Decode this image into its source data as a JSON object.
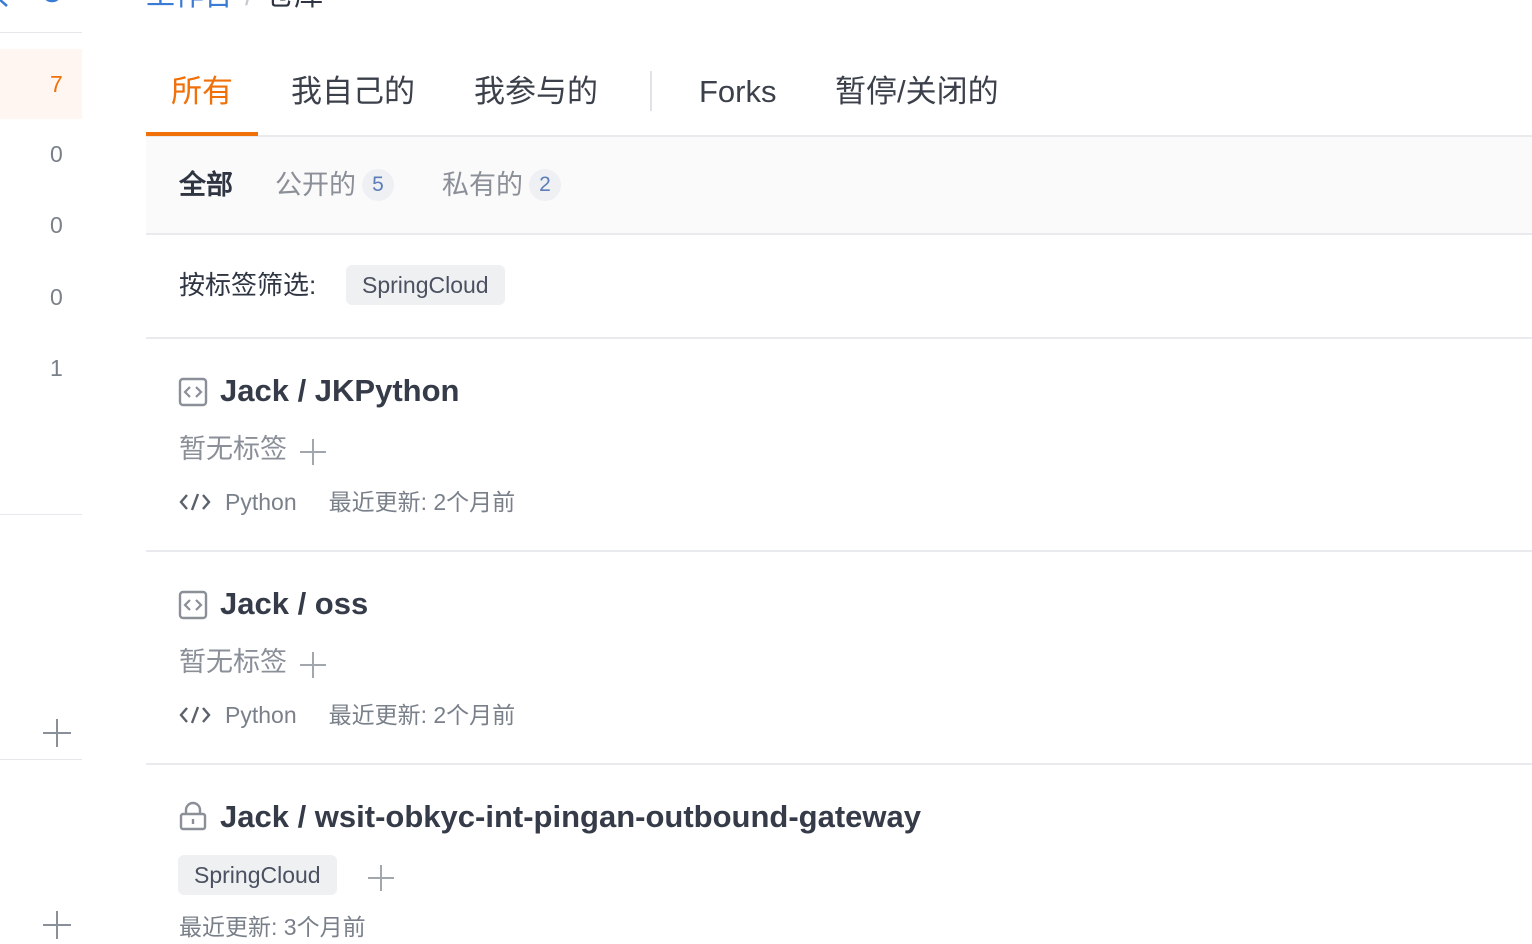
{
  "breadcrumb": {
    "parent": "工作台",
    "separator": "/",
    "current": "仓库"
  },
  "sidebar": {
    "counts": [
      "7",
      "0",
      "0",
      "0",
      "1"
    ],
    "active_index": 0
  },
  "tabs": [
    {
      "label": "所有"
    },
    {
      "label": "我自己的"
    },
    {
      "label": "我参与的"
    },
    {
      "label": "Forks"
    },
    {
      "label": "暂停/关闭的"
    }
  ],
  "subfilter": {
    "all": "全部",
    "public_label": "公开的",
    "public_count": "5",
    "private_label": "私有的",
    "private_count": "2"
  },
  "tag_filter": {
    "label": "按标签筛选:",
    "tag": "SpringCloud"
  },
  "repos": [
    {
      "title": "Jack / JKPython",
      "icon": "repo-icon",
      "tags_empty": "暂无标签",
      "language": "Python",
      "updated": "最近更新: 2个月前"
    },
    {
      "title": "Jack / oss",
      "icon": "repo-icon",
      "tags_empty": "暂无标签",
      "language": "Python",
      "updated": "最近更新: 2个月前"
    },
    {
      "title": "Jack / wsit-obkyc-int-pingan-outbound-gateway",
      "icon": "lock-icon",
      "tag": "SpringCloud",
      "updated": "最近更新: 3个月前"
    }
  ],
  "colors": {
    "accent": "#f0700a",
    "link": "#3a7bd5",
    "text": "#2f3542",
    "muted": "#8a8f98"
  }
}
